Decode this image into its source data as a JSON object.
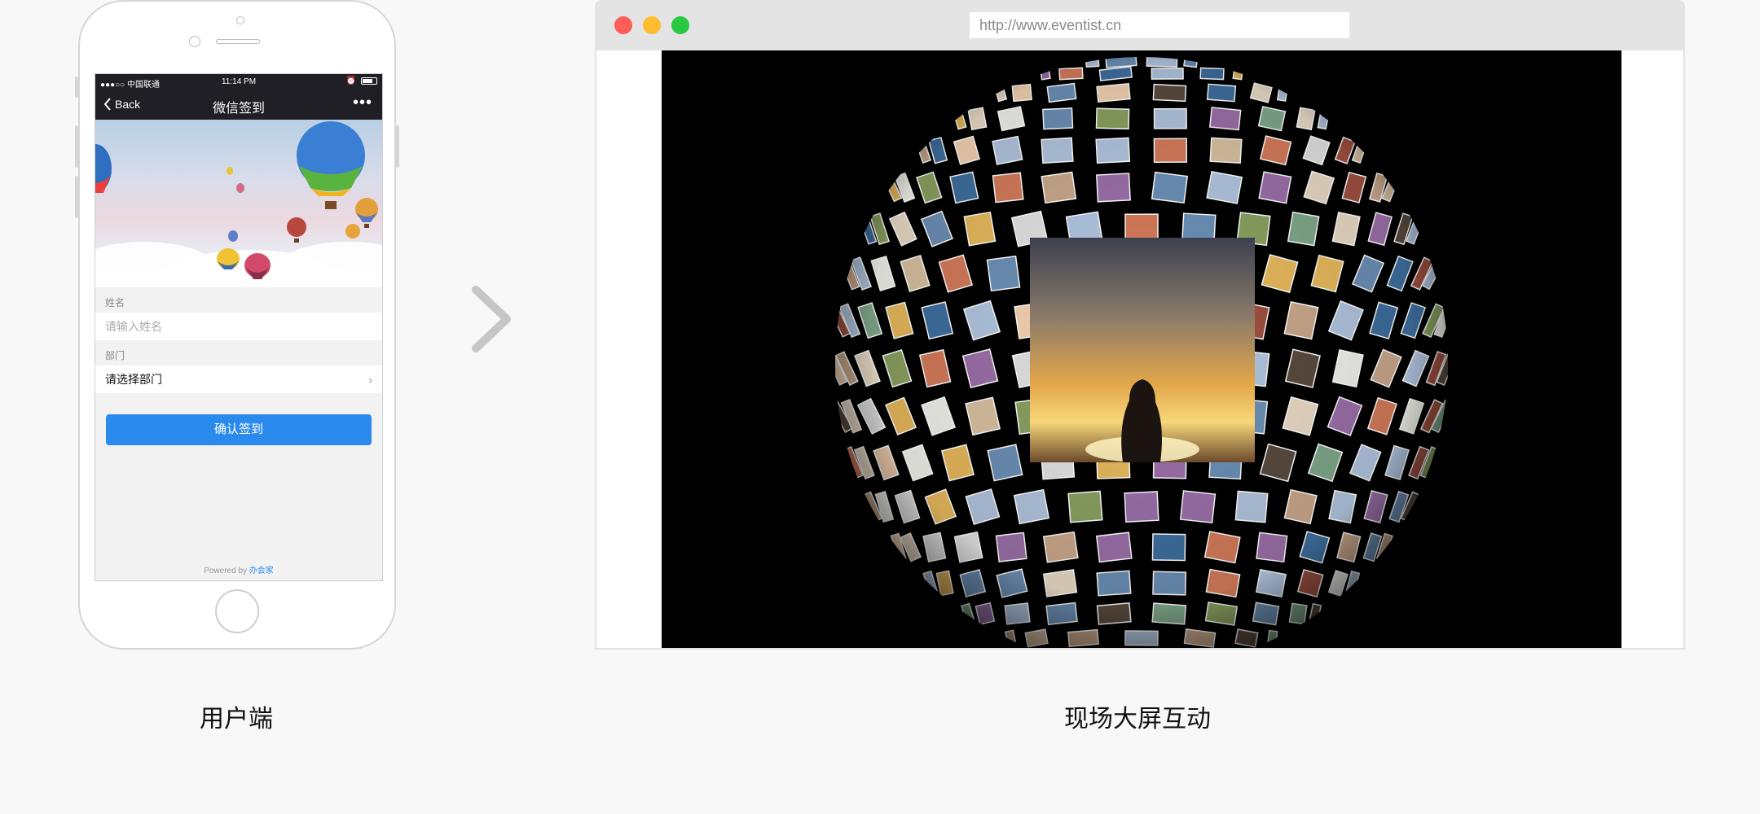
{
  "phone": {
    "status": {
      "carrier": "●●●○○ 中国联通",
      "time": "11:14 PM"
    },
    "nav": {
      "back_label": "Back",
      "title": "微信签到",
      "more_label": "•••"
    },
    "form": {
      "name_label": "姓名",
      "name_placeholder": "请输入姓名",
      "dept_label": "部门",
      "dept_value": "请选择部门"
    },
    "confirm_label": "确认签到",
    "powered_prefix": "Powered by",
    "powered_brand": "办会家"
  },
  "browser": {
    "url": "http://www.eventist.cn",
    "traffic_colors": [
      "#fe5e57",
      "#febc2e",
      "#2ac840"
    ]
  },
  "captions": {
    "left": "用户端",
    "right": "现场大屏互动"
  },
  "colors": {
    "accent": "#2b8aee",
    "nav_bg": "#1f1f25"
  }
}
